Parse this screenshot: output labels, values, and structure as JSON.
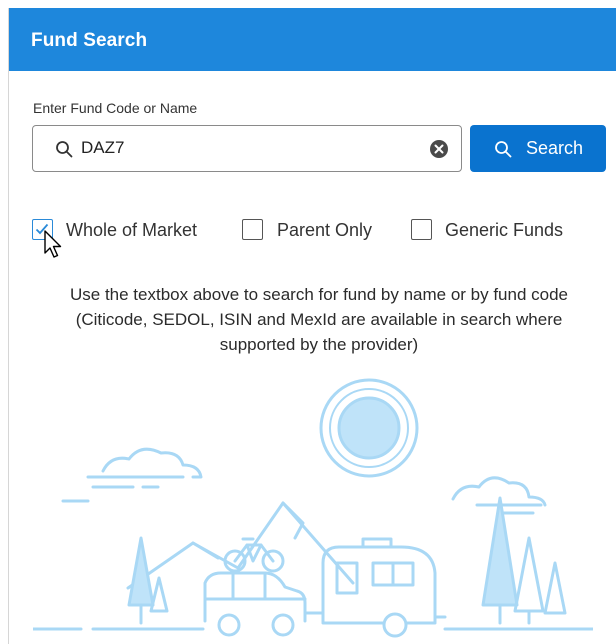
{
  "header": {
    "title": "Fund Search"
  },
  "search": {
    "label": "Enter Fund Code or Name",
    "value": "DAZ7",
    "button_label": "Search"
  },
  "filters": [
    {
      "label": "Whole of Market",
      "checked": true
    },
    {
      "label": "Parent Only",
      "checked": false
    },
    {
      "label": "Generic Funds",
      "checked": false
    }
  ],
  "help_text": {
    "line1": "Use the textbox above to search for fund by name or by fund code",
    "line2": "(Citicode, SEDOL, ISIN and MexId are available in search where",
    "line3": "supported by the provider)"
  },
  "icons": {
    "search": "search-icon",
    "clear": "clear-icon",
    "cursor": "mouse-pointer-icon",
    "empty_state": "camping-landscape-illustration"
  },
  "colors": {
    "header_bg": "#1e87dc",
    "button_bg": "#0a73cf",
    "illustration": "#a9d8f5"
  }
}
